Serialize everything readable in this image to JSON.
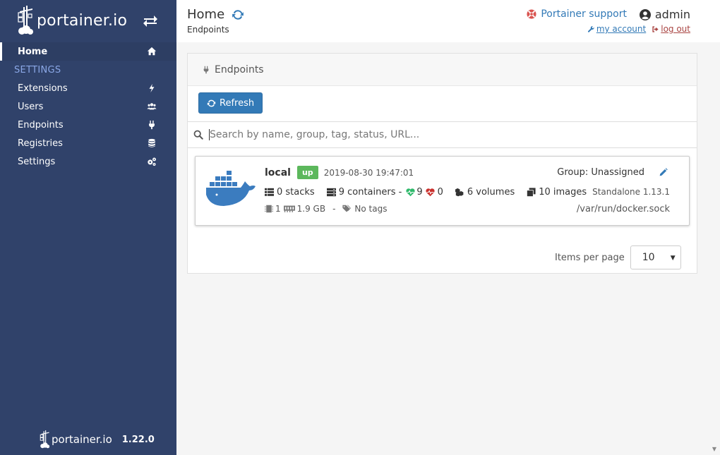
{
  "sidebar": {
    "brand": "portainer.io",
    "items": [
      {
        "label": "Home",
        "icon": "home-icon",
        "active": true
      }
    ],
    "section": "SETTINGS",
    "settings_items": [
      {
        "label": "Extensions",
        "icon": "bolt-icon"
      },
      {
        "label": "Users",
        "icon": "users-icon"
      },
      {
        "label": "Endpoints",
        "icon": "plug-icon"
      },
      {
        "label": "Registries",
        "icon": "database-icon"
      },
      {
        "label": "Settings",
        "icon": "cogs-icon"
      }
    ],
    "footer_brand": "portainer.io",
    "version": "1.22.0"
  },
  "header": {
    "title": "Home",
    "breadcrumb": "Endpoints",
    "support": "Portainer support",
    "user": "admin",
    "my_account": "my account",
    "log_out": "log out"
  },
  "panel": {
    "title": "Endpoints",
    "refresh": "Refresh",
    "search_placeholder": "Search by name, group, tag, status, URL..."
  },
  "endpoint": {
    "name": "local",
    "status": "up",
    "date": "2019-08-30 19:47:01",
    "group": "Group: Unassigned",
    "stacks": "0 stacks",
    "containers": "9 containers -",
    "healthy": "9",
    "unhealthy": "0",
    "volumes": "6 volumes",
    "images": "10 images",
    "type": "Standalone 1.13.1",
    "cpu": "1",
    "memory": "1.9 GB",
    "separator": "-",
    "tags": "No tags",
    "url": "/var/run/docker.sock"
  },
  "pager": {
    "label": "Items per page",
    "value": "10"
  },
  "colors": {
    "sidebar_bg": "#30426a",
    "primary": "#337ab7",
    "success": "#5cb85c",
    "danger": "#a94442"
  }
}
